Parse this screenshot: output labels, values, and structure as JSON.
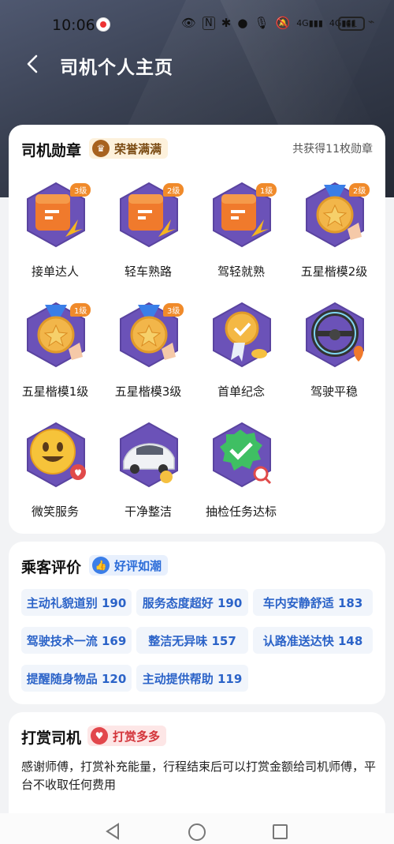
{
  "status_bar": {
    "time": "10:06",
    "network": "4G",
    "network2": "4G",
    "battery": "61"
  },
  "header": {
    "title": "司机个人主页"
  },
  "badges_section": {
    "title": "司机勋章",
    "tag": "荣誉满满",
    "count_text": "共获得11枚勋章",
    "items": [
      {
        "label": "接单达人",
        "level": "3级",
        "icon": "calendar-badge-icon"
      },
      {
        "label": "轻车熟路",
        "level": "2级",
        "icon": "calendar-badge-icon"
      },
      {
        "label": "驾轻就熟",
        "level": "1级",
        "icon": "calendar-badge-icon"
      },
      {
        "label": "五星楷模2级",
        "level": "2级",
        "icon": "star-medal-icon"
      },
      {
        "label": "五星楷模1级",
        "level": "1级",
        "icon": "star-medal-icon"
      },
      {
        "label": "五星楷模3级",
        "level": "3级",
        "icon": "star-medal-icon"
      },
      {
        "label": "首单纪念",
        "level": "",
        "icon": "ribbon-medal-icon"
      },
      {
        "label": "驾驶平稳",
        "level": "",
        "icon": "steering-wheel-icon"
      },
      {
        "label": "微笑服务",
        "level": "",
        "icon": "smiley-heart-icon"
      },
      {
        "label": "干净整洁",
        "level": "",
        "icon": "clean-car-icon"
      },
      {
        "label": "抽检任务达标",
        "level": "",
        "icon": "check-magnifier-icon"
      }
    ]
  },
  "evaluation_section": {
    "title": "乘客评价",
    "tag": "好评如潮",
    "chips": [
      "主动礼貌道别 190",
      "服务态度超好 190",
      "车内安静舒适 183",
      "驾驶技术一流 169",
      "整洁无异味 157",
      "认路准送达快 148",
      "提醒随身物品 120",
      "主动提供帮助 119"
    ]
  },
  "tip_section": {
    "title": "打赏司机",
    "tag": "打赏多多",
    "description": "感谢师傅，打赏补充能量，行程结束后可以打赏金额给司机师傅，平台不收取任何费用"
  },
  "colors": {
    "accent_blue": "#2b63c8",
    "badge_orange": "#f08a2a",
    "tip_red": "#d3343a",
    "hero_dark": "#383f50"
  }
}
